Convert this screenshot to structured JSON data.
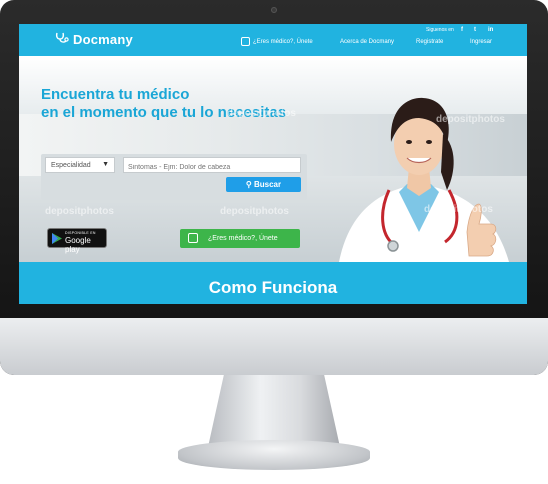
{
  "header": {
    "logo_text": "Docmany",
    "follow_label": "Siguenos en",
    "social": [
      "f",
      "t",
      "in"
    ],
    "nav": {
      "doctor_cta": "¿Eres médico?, Únete",
      "about": "Acerca de Docmany",
      "register": "Registrate",
      "login": "Ingresar"
    }
  },
  "hero": {
    "headline_line1": "Encuentra tu médico",
    "headline_line2": "en el momento que tu lo necesitas",
    "search": {
      "specialty_value": "Especialidad",
      "symptom_placeholder": "Sintomas - Ejm: Dolor de cabeza",
      "button_label": "Buscar"
    },
    "google_play": {
      "small": "DISPONIBLE EN",
      "big": "Google play"
    },
    "doctor_button": "¿Eres médico?, Únete",
    "watermark": "depositphotos"
  },
  "section": {
    "title": "Como Funciona"
  },
  "colors": {
    "primary": "#21b3e0",
    "button_blue": "#1f9ee8",
    "button_green": "#3db54a",
    "headline": "#1aa6d6"
  }
}
